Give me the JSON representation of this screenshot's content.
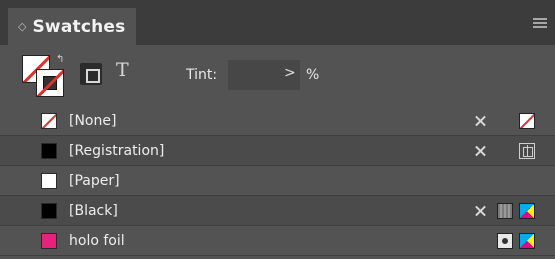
{
  "panel": {
    "title": "Swatches",
    "collapse_glyph": "◇",
    "menu_icon": "panel-menu-icon"
  },
  "controls": {
    "fill_stroke_icon": "fill-stroke-icon",
    "swap_glyph": "↰",
    "container_icon": "formatting-container-icon",
    "text_glyph": "T",
    "tint_label": "Tint:",
    "tint_value": "",
    "tint_arrow": ">",
    "tint_unit": "%"
  },
  "swatches": [
    {
      "label": "[None]",
      "color": "none",
      "icons": [
        "cannot-edit-icon",
        "none-mode-icon"
      ]
    },
    {
      "label": "[Registration]",
      "color": "#000000",
      "icons": [
        "cannot-edit-icon",
        "registration-mode-icon"
      ]
    },
    {
      "label": "[Paper]",
      "color": "#ffffff",
      "icons": []
    },
    {
      "label": "[Black]",
      "color": "#000000",
      "icons": [
        "cannot-edit-icon",
        "process-color-icon",
        "cmyk-mode-icon"
      ]
    },
    {
      "label": "holo foil",
      "color": "#e8217a",
      "icons": [
        "spot-color-icon",
        "cmyk-mode-icon"
      ]
    }
  ],
  "colors": {
    "panel_bg": "#535353",
    "tabbar_bg": "#3c3c3c",
    "none_red": "#e0302a",
    "holo_foil": "#e8217a"
  }
}
